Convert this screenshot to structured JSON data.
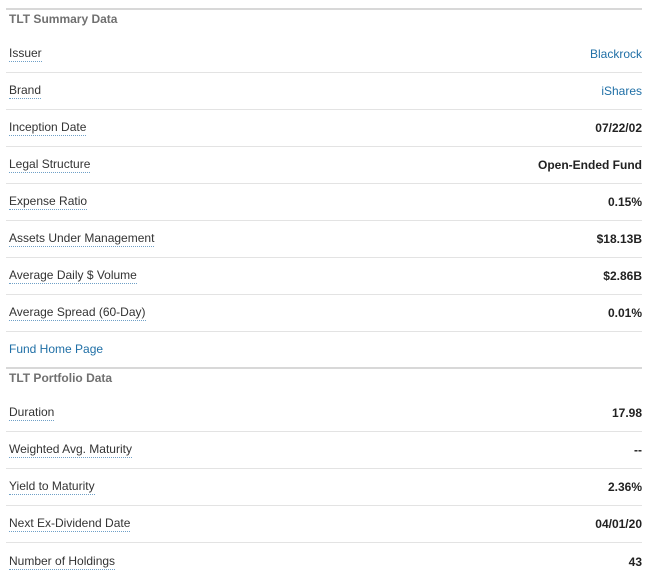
{
  "summary": {
    "title": "TLT Summary Data",
    "rows": [
      {
        "label": "Issuer",
        "value": "Blackrock",
        "link": true
      },
      {
        "label": "Brand",
        "value": "iShares",
        "link": true
      },
      {
        "label": "Inception Date",
        "value": "07/22/02",
        "link": false
      },
      {
        "label": "Legal Structure",
        "value": "Open-Ended Fund",
        "link": false
      },
      {
        "label": "Expense Ratio",
        "value": "0.15%",
        "link": false
      },
      {
        "label": "Assets Under Management",
        "value": "$18.13B",
        "link": false
      },
      {
        "label": "Average Daily $ Volume",
        "value": "$2.86B",
        "link": false
      },
      {
        "label": "Average Spread (60-Day)",
        "value": "0.01%",
        "link": false
      }
    ],
    "fund_home_page": "Fund Home Page"
  },
  "portfolio": {
    "title": "TLT Portfolio Data",
    "rows": [
      {
        "label": "Duration",
        "value": "17.98"
      },
      {
        "label": "Weighted Avg. Maturity",
        "value": "--"
      },
      {
        "label": "Yield to Maturity",
        "value": "2.36%"
      },
      {
        "label": "Next Ex-Dividend Date",
        "value": "04/01/20"
      },
      {
        "label": "Number of Holdings",
        "value": "43"
      }
    ]
  }
}
